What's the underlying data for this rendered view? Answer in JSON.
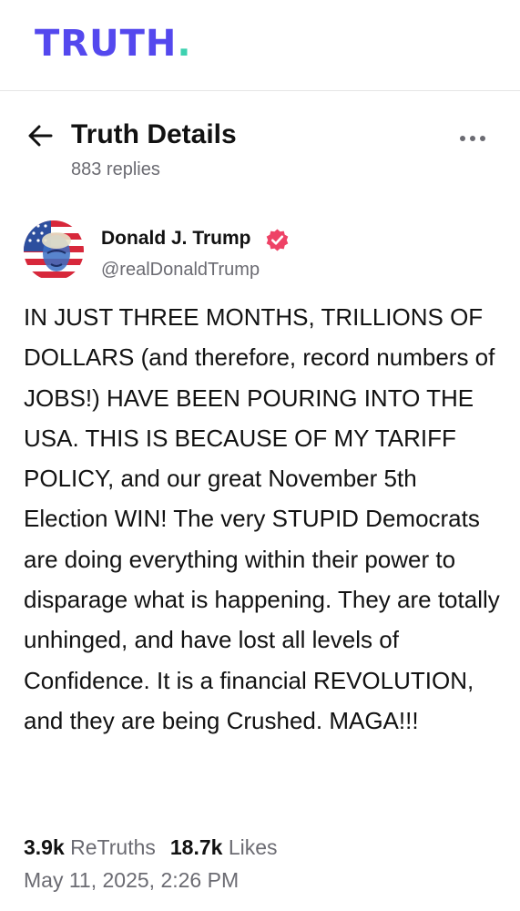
{
  "app": {
    "logo_text": "TRUTH",
    "logo_dot": ".",
    "brand_color": "#5448ee",
    "accent_color": "#3dd1b0"
  },
  "header": {
    "back_icon": "arrow-left-icon",
    "title": "Truth Details",
    "replies": "883 replies",
    "more_icon": "more-horizontal-icon"
  },
  "author": {
    "name": "Donald J. Trump",
    "handle": "@realDonaldTrump",
    "verified_icon": "verified-badge-icon",
    "verified_color": "#ee4266"
  },
  "post": {
    "text": "IN JUST THREE MONTHS, TRILLIONS OF DOLLARS (and therefore, record numbers of JOBS!) HAVE BEEN POURING INTO THE USA. THIS IS BECAUSE OF MY TARIFF POLICY, and our great November 5th Election WIN! The very STUPID Democrats are doing everything within their power to disparage what is happening. They are totally unhinged, and have lost all levels of Confidence. It is a financial REVOLUTION, and they are being Crushed. MAGA!!!",
    "retruths_count": "3.9k",
    "retruths_label": "ReTruths",
    "likes_count": "18.7k",
    "likes_label": "Likes",
    "timestamp": "May 11, 2025, 2:26 PM"
  }
}
